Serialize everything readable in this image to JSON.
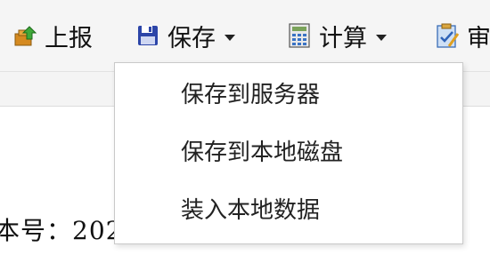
{
  "toolbar": {
    "report": {
      "label": "上报",
      "icon": "upload-arrow-icon"
    },
    "save": {
      "label": "保存",
      "icon": "floppy-disk-icon"
    },
    "calculate": {
      "label": "计算",
      "icon": "calculator-icon"
    },
    "review": {
      "label": "审",
      "icon": "clipboard-check-icon"
    }
  },
  "save_menu": {
    "items": [
      {
        "label": "保存到服务器"
      },
      {
        "label": "保存到本地磁盘"
      },
      {
        "label": "装入本地数据"
      }
    ]
  },
  "document": {
    "partial_text": "本号：202"
  }
}
